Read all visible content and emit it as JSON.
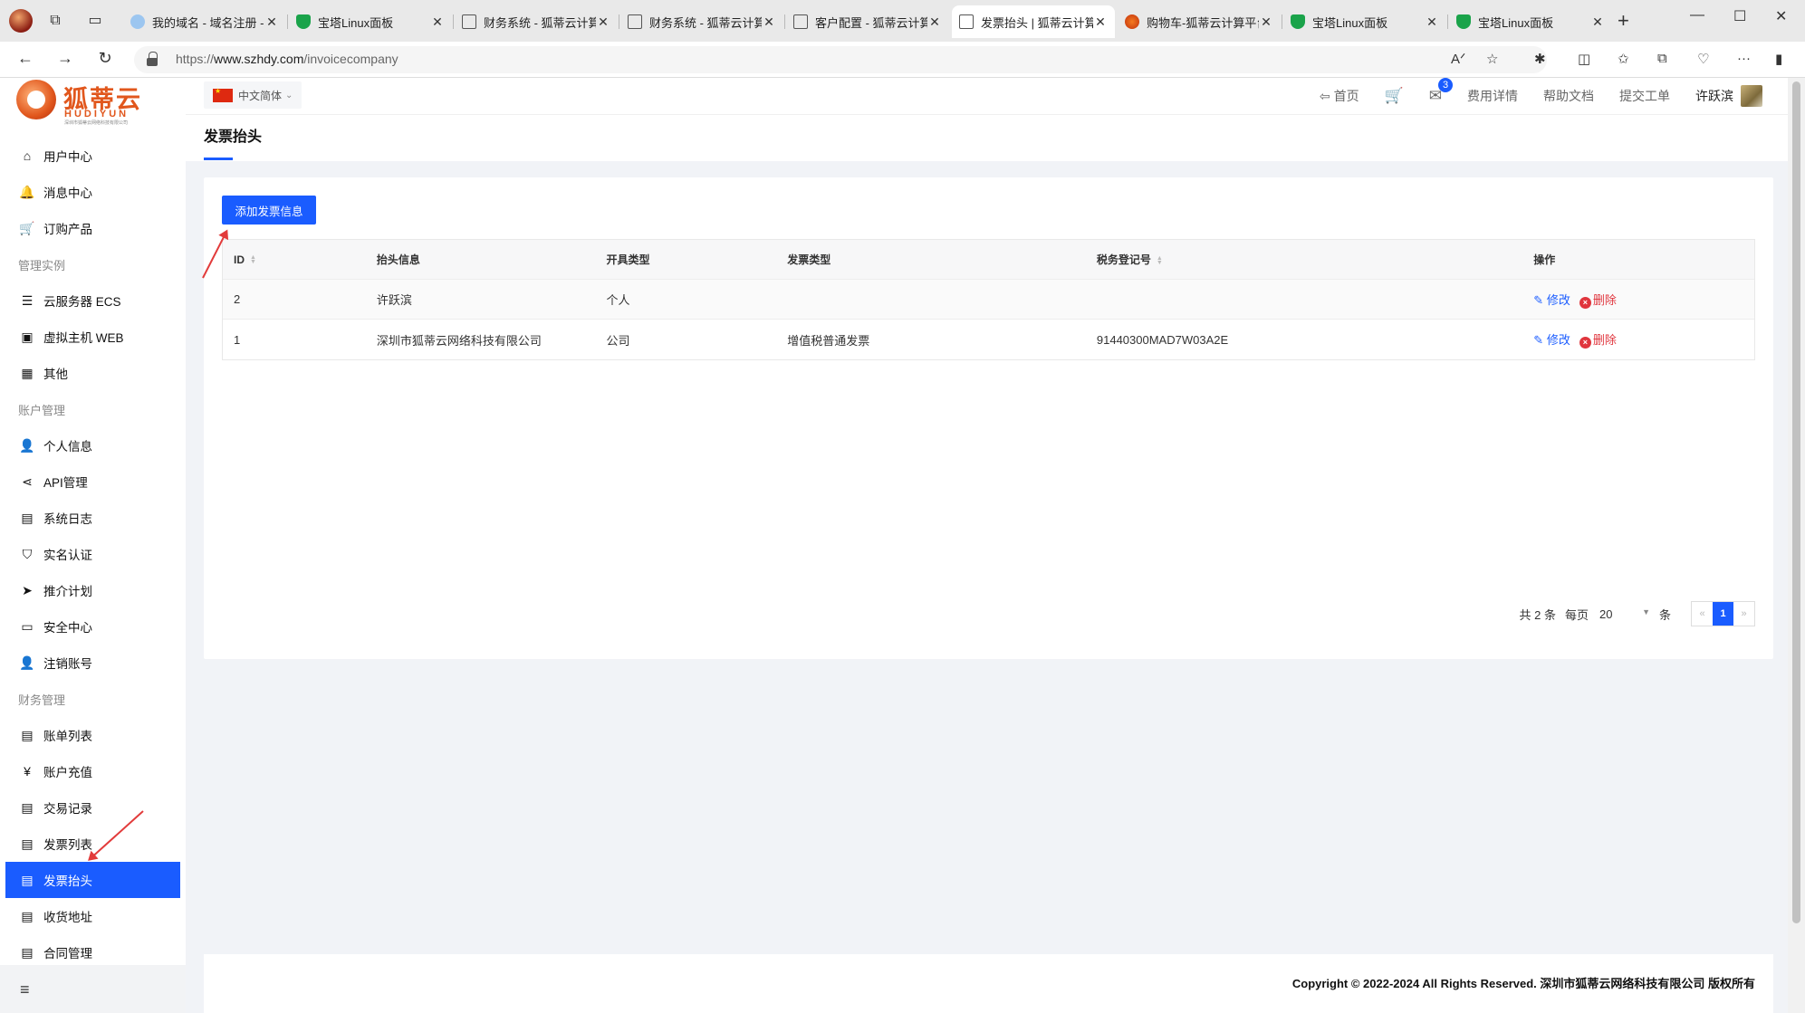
{
  "browser": {
    "tabs": [
      {
        "label": "我的域名 - 域名注册 -",
        "icon": "cloud-icon",
        "active": false
      },
      {
        "label": "宝塔Linux面板",
        "icon": "shield-icon",
        "active": false
      },
      {
        "label": "财务系统 - 狐蒂云计算",
        "icon": "doc-icon",
        "active": false
      },
      {
        "label": "财务系统 - 狐蒂云计算",
        "icon": "doc-icon",
        "active": false
      },
      {
        "label": "客户配置 - 狐蒂云计算",
        "icon": "doc-icon",
        "active": false
      },
      {
        "label": "发票抬头 | 狐蒂云计算",
        "icon": "doc-icon",
        "active": true
      },
      {
        "label": "购物车-狐蒂云计算平台",
        "icon": "fox-icon",
        "active": false
      },
      {
        "label": "宝塔Linux面板",
        "icon": "shield-icon",
        "active": false
      },
      {
        "label": "宝塔Linux面板",
        "icon": "shield-icon",
        "active": false
      }
    ],
    "url_prefix": "https://",
    "url_host": "www.szhdy.com",
    "url_path": "/invoicecompany"
  },
  "logo": {
    "cn": "狐蒂云",
    "en": "HUDIYUN",
    "tagline": "深圳市狐蒂云网络科技有限公司"
  },
  "sidebar": {
    "items": [
      {
        "type": "item",
        "label": "用户中心",
        "icon": "home-icon",
        "glyph": "⌂"
      },
      {
        "type": "item",
        "label": "消息中心",
        "icon": "bell-icon",
        "glyph": "🔔"
      },
      {
        "type": "item",
        "label": "订购产品",
        "icon": "cart-icon",
        "glyph": "🛒"
      },
      {
        "type": "group",
        "label": "管理实例"
      },
      {
        "type": "item",
        "label": "云服务器 ECS",
        "icon": "server-icon",
        "glyph": "☰"
      },
      {
        "type": "item",
        "label": "虚拟主机 WEB",
        "icon": "host-icon",
        "glyph": "▣"
      },
      {
        "type": "item",
        "label": "其他",
        "icon": "grid-icon",
        "glyph": "▦"
      },
      {
        "type": "group",
        "label": "账户管理"
      },
      {
        "type": "item",
        "label": "个人信息",
        "icon": "user-icon",
        "glyph": "👤"
      },
      {
        "type": "item",
        "label": "API管理",
        "icon": "share-icon",
        "glyph": "⋖"
      },
      {
        "type": "item",
        "label": "系统日志",
        "icon": "log-icon",
        "glyph": "▤"
      },
      {
        "type": "item",
        "label": "实名认证",
        "icon": "verify-shield-icon",
        "glyph": "⛉"
      },
      {
        "type": "item",
        "label": "推介计划",
        "icon": "paper-plane-icon",
        "glyph": "➤"
      },
      {
        "type": "item",
        "label": "安全中心",
        "icon": "id-card-icon",
        "glyph": "▭"
      },
      {
        "type": "item",
        "label": "注销账号",
        "icon": "user-off-icon",
        "glyph": "👤"
      },
      {
        "type": "group",
        "label": "财务管理"
      },
      {
        "type": "item",
        "label": "账单列表",
        "icon": "bill-icon",
        "glyph": "▤"
      },
      {
        "type": "item",
        "label": "账户充值",
        "icon": "yen-icon",
        "glyph": "¥"
      },
      {
        "type": "item",
        "label": "交易记录",
        "icon": "record-icon",
        "glyph": "▤"
      },
      {
        "type": "item",
        "label": "发票列表",
        "icon": "invoice-list-icon",
        "glyph": "▤"
      },
      {
        "type": "item",
        "label": "发票抬头",
        "icon": "invoice-header-icon",
        "glyph": "▤",
        "active": true
      },
      {
        "type": "item",
        "label": "收货地址",
        "icon": "address-icon",
        "glyph": "▤"
      },
      {
        "type": "item",
        "label": "合同管理",
        "icon": "contract-icon",
        "glyph": "▤"
      }
    ]
  },
  "header": {
    "language": "中文简体",
    "home": "首页",
    "message_count": "3",
    "fee_details": "费用详情",
    "help_docs": "帮助文档",
    "submit_ticket": "提交工单",
    "username": "许跃滨"
  },
  "page_title": "发票抬头",
  "add_button": "添加发票信息",
  "table": {
    "columns": {
      "id": "ID",
      "header_info": "抬头信息",
      "issue_type": "开具类型",
      "invoice_type": "发票类型",
      "tax_no": "税务登记号",
      "actions": "操作"
    },
    "rows": [
      {
        "id": "2",
        "header_info": "许跃滨",
        "issue_type": "个人",
        "invoice_type": "",
        "tax_no": ""
      },
      {
        "id": "1",
        "header_info": "深圳市狐蒂云网络科技有限公司",
        "issue_type": "公司",
        "invoice_type": "增值税普通发票",
        "tax_no": "91440300MAD7W03A2E"
      }
    ],
    "edit_label": "修改",
    "delete_label": "删除"
  },
  "pagination": {
    "total_prefix": "共",
    "total": "2",
    "total_suffix": "条",
    "per_page_label": "每页",
    "per_page": "20",
    "per_page_unit": "条",
    "current_page": "1",
    "prev": "«",
    "next": "»"
  },
  "footer": {
    "copyright": "Copyright © 2022-2024 All Rights Reserved. 深圳市狐蒂云网络科技有限公司 版权所有"
  },
  "colors": {
    "accent": "#1a5cff",
    "danger": "#e0353d",
    "annotation": "#e23b3b",
    "brand": "#e1571d"
  }
}
